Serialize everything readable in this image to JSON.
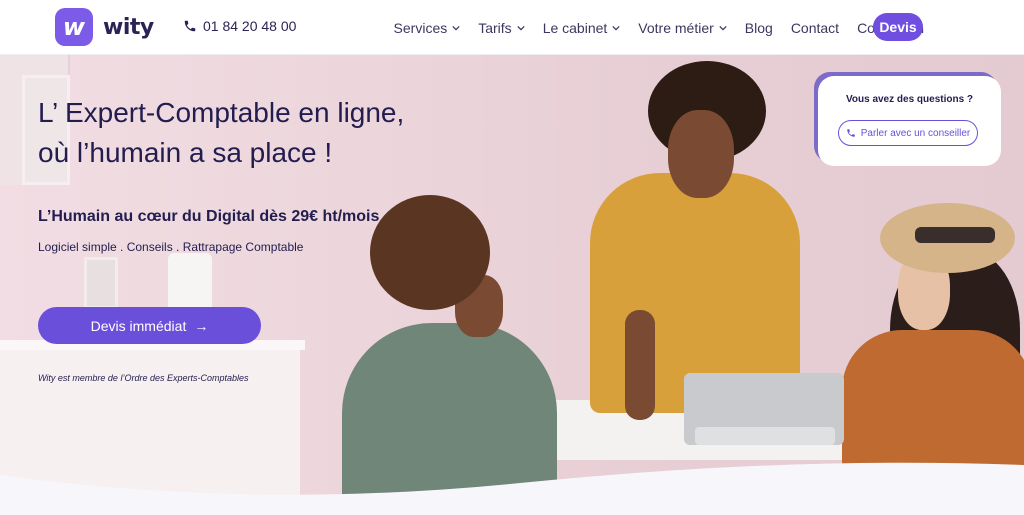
{
  "brand": {
    "logo_letter": "w",
    "name": "wity",
    "color": "#6f4ee0"
  },
  "header": {
    "phone": "01 84 20 48 00",
    "nav": [
      {
        "label": "Services",
        "has_dropdown": true
      },
      {
        "label": "Tarifs",
        "has_dropdown": true
      },
      {
        "label": "Le cabinet",
        "has_dropdown": true
      },
      {
        "label": "Votre métier",
        "has_dropdown": true
      },
      {
        "label": "Blog",
        "has_dropdown": false
      },
      {
        "label": "Contact",
        "has_dropdown": false
      },
      {
        "label": "Connexion",
        "has_dropdown": false
      }
    ],
    "cta_label": "Devis"
  },
  "hero": {
    "title_line1": "L’ Expert-Comptable en ligne,",
    "title_line2": "où l’humain a sa place !",
    "subtitle": "L’Humain au cœur du Digital dès 29€ ht/mois",
    "tags": "Logiciel simple . Conseils . Rattrapage Comptable",
    "cta_label": "Devis immédiat",
    "cta_arrow": "→",
    "footnote": "Wity est membre de l’Ordre des Experts-Comptables"
  },
  "question_card": {
    "title": "Vous avez des questions ?",
    "button_label": "Parler avec un conseiller"
  },
  "icons": {
    "phone": "phone-icon",
    "chevron": "chevron-down-icon",
    "arrow": "arrow-right-icon"
  }
}
